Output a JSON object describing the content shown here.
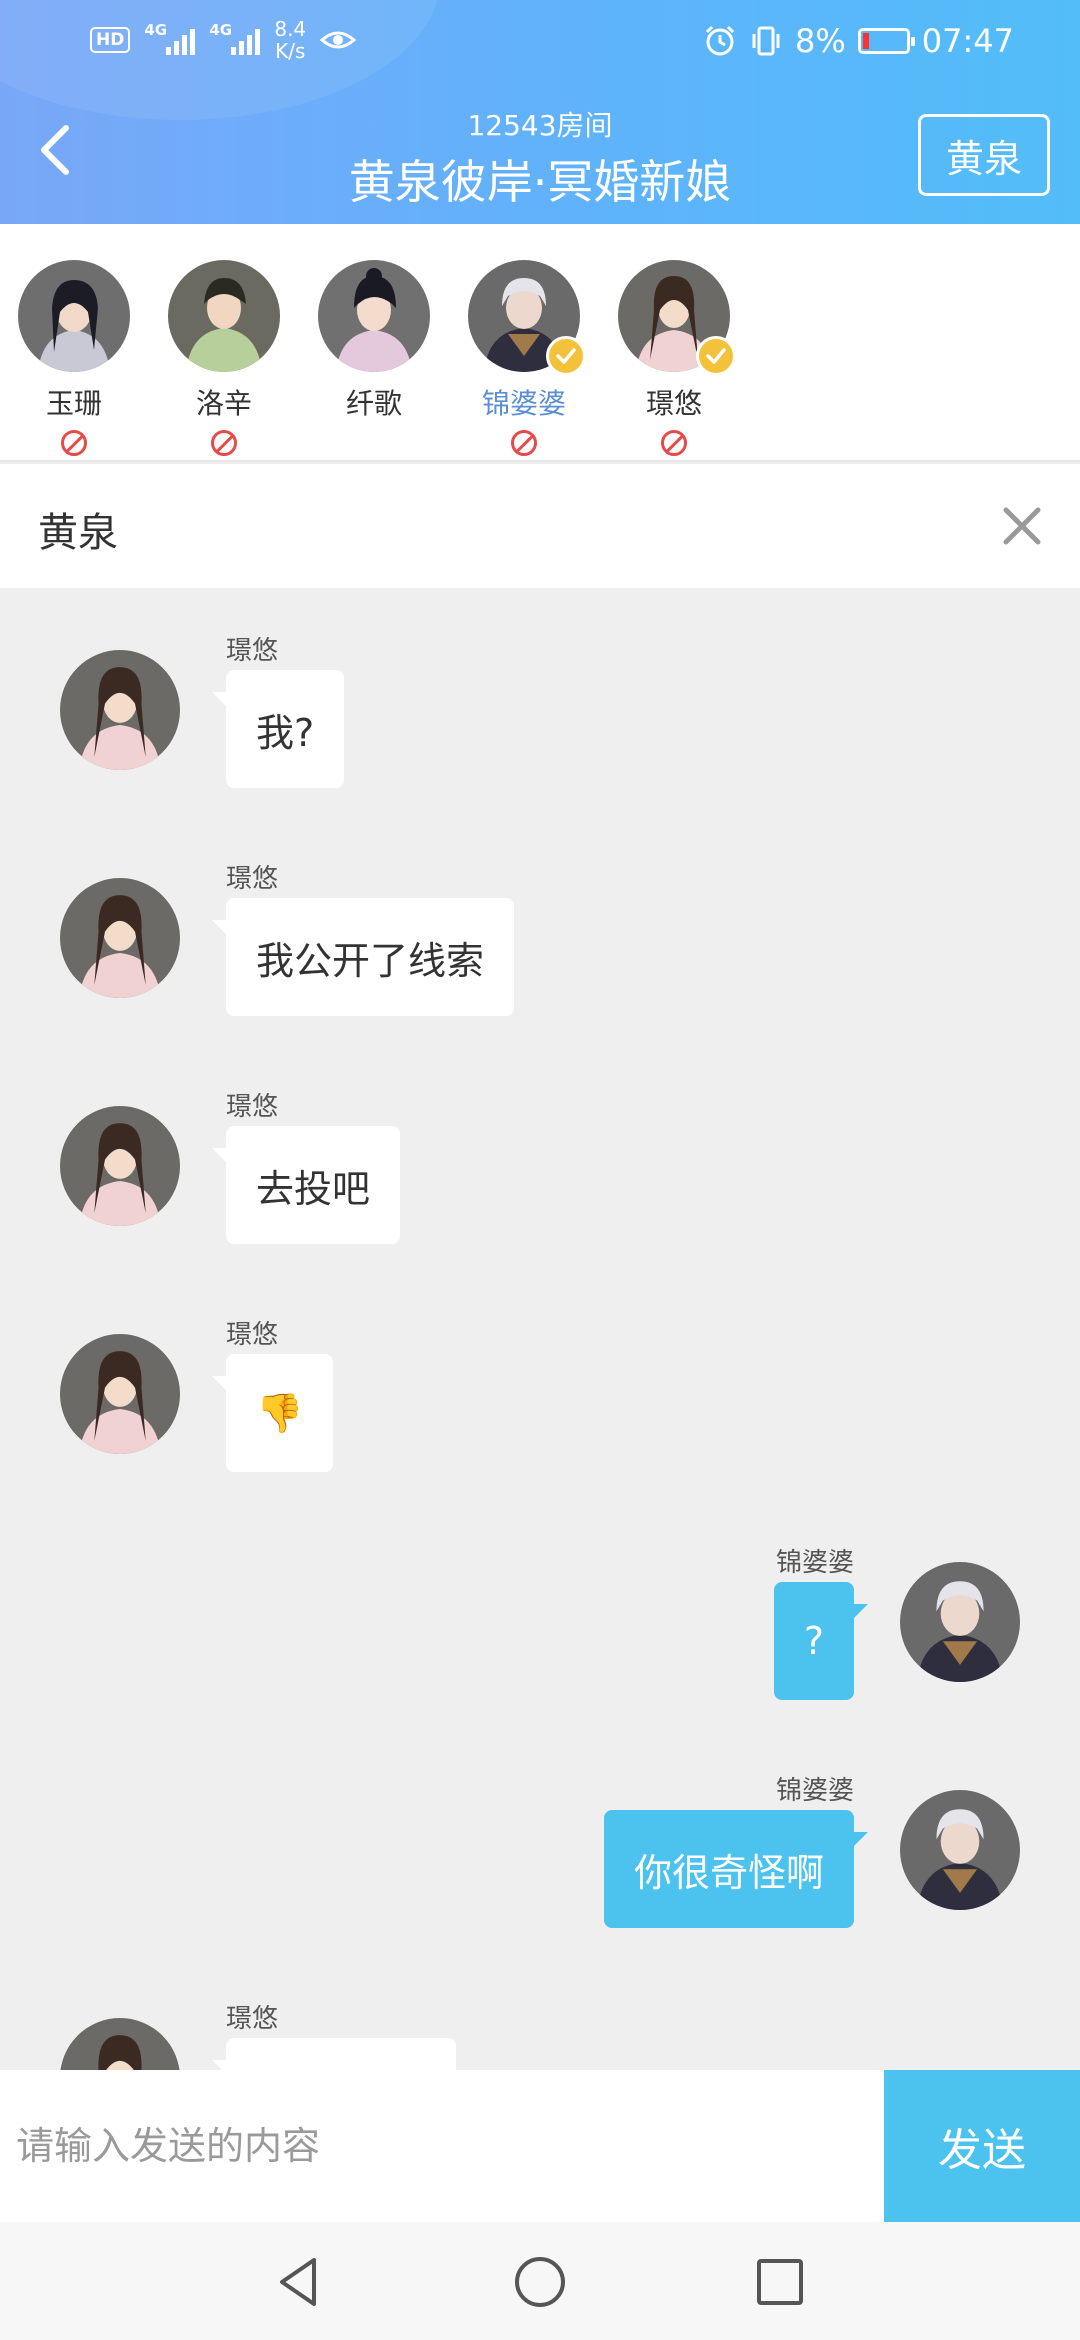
{
  "status_bar": {
    "hd": "HD",
    "net1": "4G",
    "net2": "4G",
    "speed_value": "8.4",
    "speed_unit": "K/s",
    "battery_pct": "8%",
    "time": "07:47"
  },
  "header": {
    "room_number": "12543房间",
    "room_title": "黄泉彼岸·冥婚新娘",
    "role_button": "黄泉",
    "gradient_start": "#79a7f8",
    "gradient_end": "#52bdf9"
  },
  "players": [
    {
      "name": "玉珊",
      "banned": true,
      "checked": false,
      "active": false
    },
    {
      "name": "洛辛",
      "banned": true,
      "checked": false,
      "active": false
    },
    {
      "name": "纤歌",
      "banned": false,
      "checked": false,
      "active": false
    },
    {
      "name": "锦婆婆",
      "banned": true,
      "checked": true,
      "active": true
    },
    {
      "name": "璟悠",
      "banned": true,
      "checked": true,
      "active": false
    }
  ],
  "channel": {
    "name": "黄泉"
  },
  "messages": [
    {
      "side": "left",
      "sender": "璟悠",
      "text": "我?"
    },
    {
      "side": "left",
      "sender": "璟悠",
      "text": "我公开了线索"
    },
    {
      "side": "left",
      "sender": "璟悠",
      "text": "去投吧"
    },
    {
      "side": "left",
      "sender": "璟悠",
      "text": "👎"
    },
    {
      "side": "right",
      "sender": "锦婆婆",
      "text": "?"
    },
    {
      "side": "right",
      "sender": "锦婆婆",
      "text": "你很奇怪啊"
    },
    {
      "side": "left",
      "sender": "璟悠",
      "text": ""
    }
  ],
  "input": {
    "placeholder": "请输入发送的内容",
    "send_label": "发送"
  },
  "colors": {
    "accent": "#4bc3ee",
    "active_name": "#5b8fd1",
    "ban": "#e84a4a",
    "check": "#f4c23a"
  }
}
